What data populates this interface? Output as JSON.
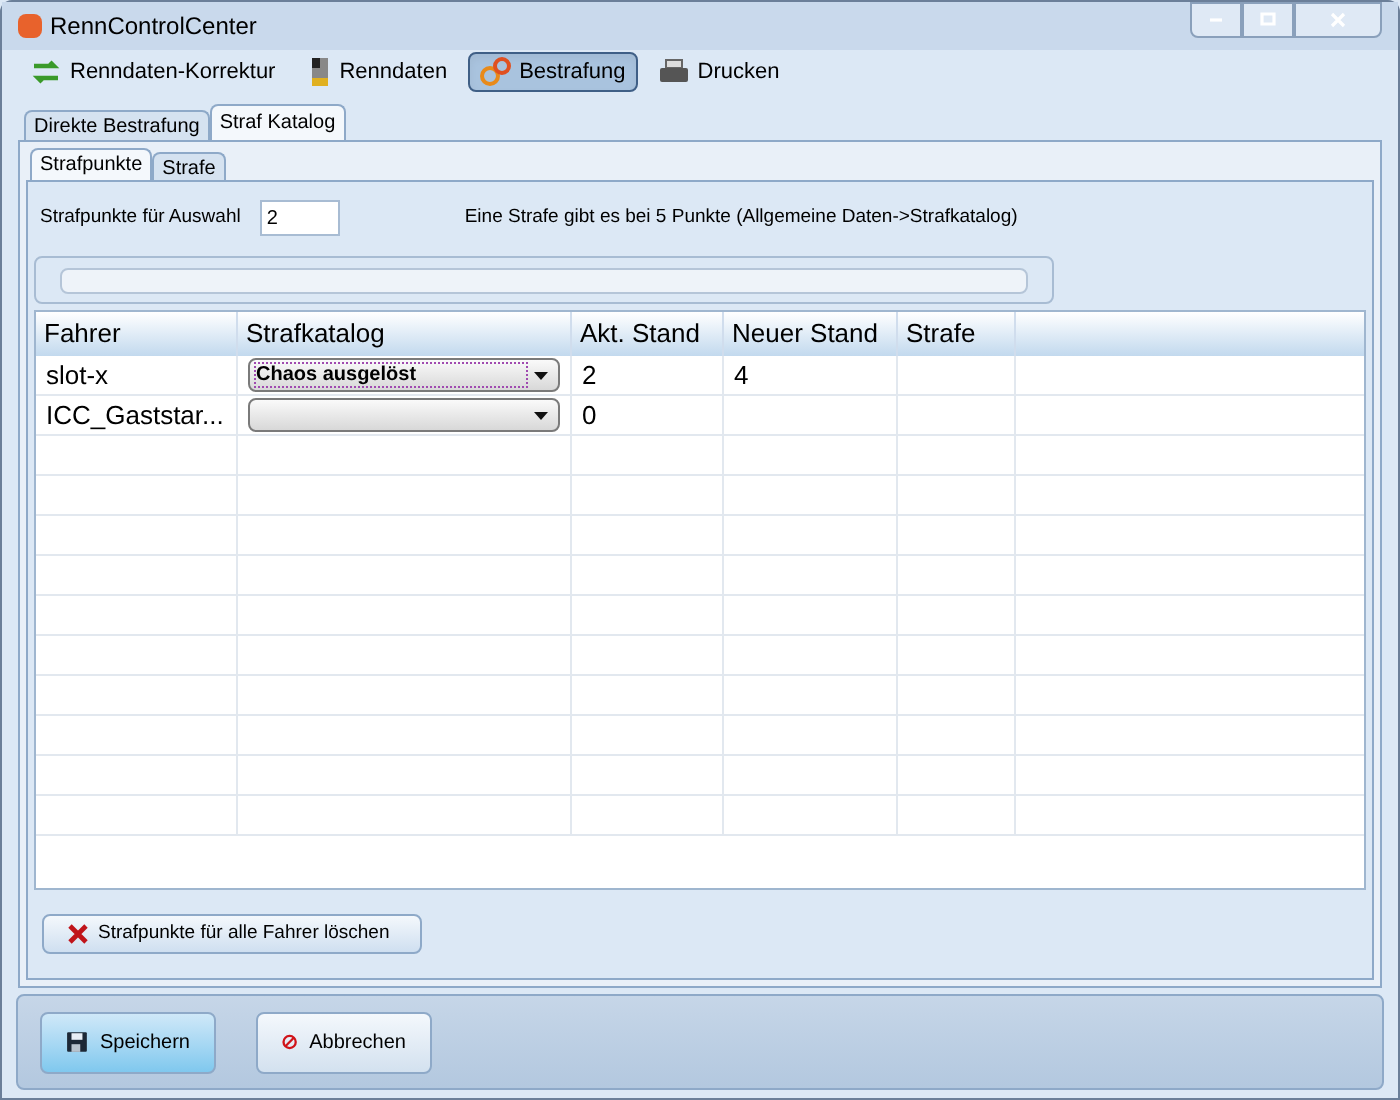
{
  "window": {
    "title": "RennControlCenter"
  },
  "toolbar": [
    {
      "label": "Renndaten-Korrektur",
      "kind": "arrows",
      "selected": false
    },
    {
      "label": "Renndaten",
      "kind": "flag",
      "selected": false
    },
    {
      "label": "Bestrafung",
      "kind": "gears",
      "selected": true
    },
    {
      "label": "Drucken",
      "kind": "printer",
      "selected": false
    }
  ],
  "tabs": [
    {
      "label": "Direkte Bestrafung",
      "selected": false
    },
    {
      "label": "Straf Katalog",
      "selected": true
    }
  ],
  "subtabs": [
    {
      "label": "Strafpunkte",
      "selected": true
    },
    {
      "label": "Strafe",
      "selected": false
    }
  ],
  "points_label": "Strafpunkte für Auswahl",
  "points_value": "2",
  "hint": "Eine Strafe gibt es bei 5 Punkte (Allgemeine Daten->Strafkatalog)",
  "progress": {
    "level": 0
  },
  "table": {
    "columns": [
      "Fahrer",
      "Strafkatalog",
      "Akt. Stand",
      "Neuer Stand",
      "Strafe"
    ],
    "rows": [
      {
        "fahrer": "slot-x",
        "katalog": "Chaos ausgelöst",
        "focused": true,
        "akt": "2",
        "neu": "4"
      },
      {
        "fahrer": "ICC_Gaststar...",
        "focused": false,
        "akt": "0"
      }
    ]
  },
  "clear_button": "Strafpunkte für alle Fahrer löschen",
  "buttons": [
    {
      "label": "Speichern",
      "kind": "save",
      "selected": true
    },
    {
      "label": "Abbrechen",
      "kind": "cancel",
      "selected": false
    }
  ]
}
